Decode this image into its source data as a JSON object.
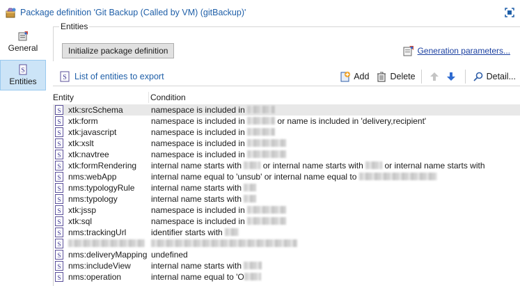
{
  "window": {
    "title": "Package definition 'Git Backup (Called by VM) (gitBackup)'",
    "icons": {
      "package": "package-icon",
      "maximize": "maximize-icon"
    }
  },
  "sidebar": {
    "items": [
      {
        "label": "General",
        "icon": "general-icon",
        "active": false
      },
      {
        "label": "Entities",
        "icon": "entities-icon",
        "active": true
      }
    ]
  },
  "entities_group": {
    "legend": "Entities",
    "init_button": "Initialize package definition",
    "gen_link": "Generation parameters..."
  },
  "toolbar": {
    "list_title": "List of entities to export",
    "add": "Add",
    "delete": "Delete",
    "detail": "Detail..."
  },
  "grid": {
    "columns": [
      "Entity",
      "Condition"
    ],
    "rows": [
      {
        "entity": "xtk:srcSchema",
        "condition": [
          "namespace is included in ",
          "~40"
        ],
        "selected": true
      },
      {
        "entity": "xtk:form",
        "condition": [
          "namespace is included in ",
          "~40",
          " or name is included in 'delivery,recipient'"
        ]
      },
      {
        "entity": "xtk:javascript",
        "condition": [
          "namespace is included in ",
          "~40"
        ]
      },
      {
        "entity": "xtk:xslt",
        "condition": [
          "namespace is included in ",
          "~56"
        ]
      },
      {
        "entity": "xtk:navtree",
        "condition": [
          "namespace is included in ",
          "~56"
        ]
      },
      {
        "entity": "xtk:formRendering",
        "condition": [
          "internal name starts with ",
          "~24",
          " or internal name starts with ",
          "~24",
          " or internal name starts with"
        ]
      },
      {
        "entity": "nms:webApp",
        "condition": [
          "internal name equal to 'unsub' or internal name equal to ",
          "~112"
        ]
      },
      {
        "entity": "nms:typologyRule",
        "condition": [
          "internal name starts with ",
          "~18"
        ]
      },
      {
        "entity": "nms:typology",
        "condition": [
          "internal name starts with ",
          "~18"
        ]
      },
      {
        "entity": "xtk:jssp",
        "condition": [
          "namespace is included in ",
          "~56"
        ]
      },
      {
        "entity": "xtk:sql",
        "condition": [
          "namespace is included in ",
          "~56"
        ]
      },
      {
        "entity": "nms:trackingUrl",
        "condition": [
          "identifier starts with ",
          "~20"
        ]
      },
      {
        "entity": "",
        "condition": [
          "",
          "~210"
        ],
        "redacted_entity": true
      },
      {
        "entity": "nms:deliveryMapping",
        "condition": [
          "undefined"
        ]
      },
      {
        "entity": "nms:includeView",
        "condition": [
          "internal name starts with ",
          "~26"
        ]
      },
      {
        "entity": "nms:operation",
        "condition": [
          "internal name equal to 'O",
          "~24"
        ]
      }
    ]
  },
  "colors": {
    "title_blue": "#1f5fa8",
    "link_blue": "#1a3fa0",
    "active_side_bg": "#cce4f7",
    "selected_row_bg": "#e8e8e8"
  }
}
